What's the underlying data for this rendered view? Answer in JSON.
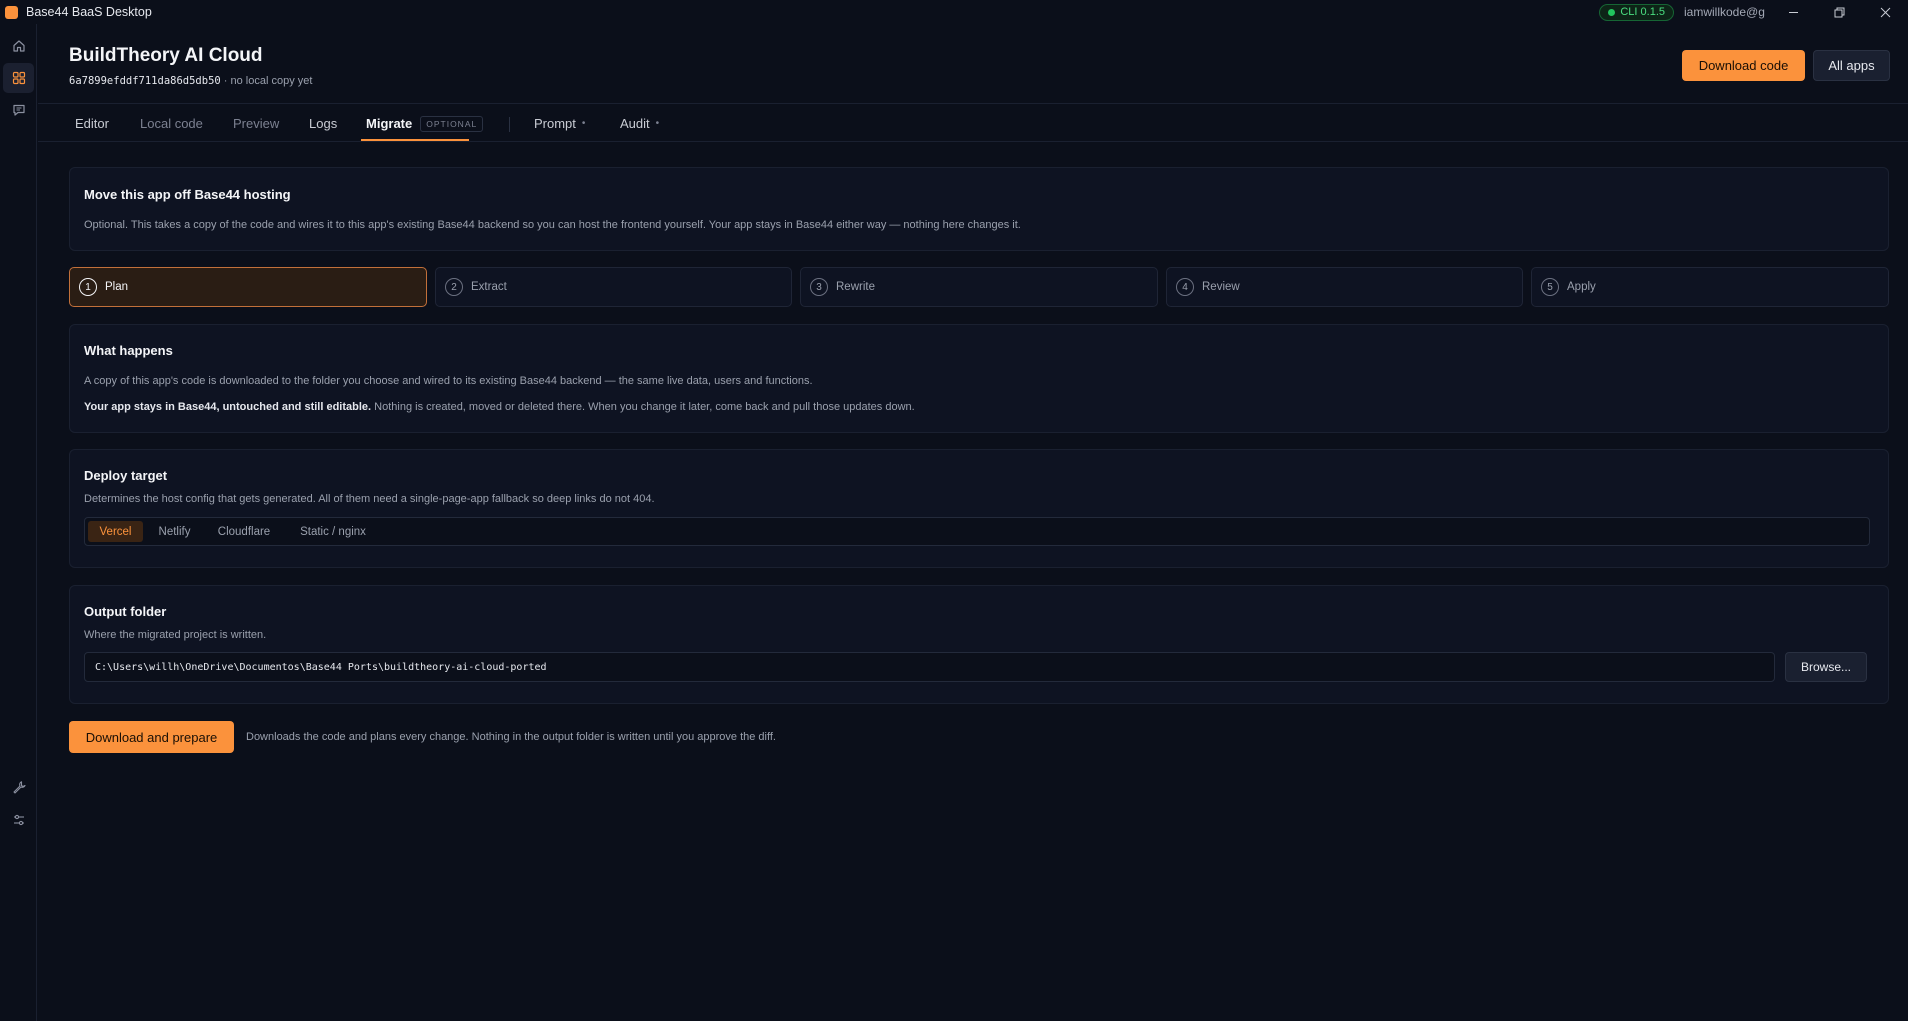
{
  "window": {
    "title": "Base44 BaaS Desktop",
    "cli_badge": "CLI 0.1.5",
    "user": "iamwillkode@g"
  },
  "header": {
    "app_name": "BuildTheory AI Cloud",
    "app_id": "6a7899efddf711da86d5db50",
    "app_status": "· no local copy yet",
    "download_code": "Download code",
    "all_apps": "All apps"
  },
  "tabs": {
    "editor": "Editor",
    "local_code": "Local code",
    "preview": "Preview",
    "logs": "Logs",
    "migrate": "Migrate",
    "migrate_badge": "OPTIONAL",
    "prompt": "Prompt",
    "audit": "Audit",
    "dot": "•"
  },
  "intro": {
    "title": "Move this app off Base44 hosting",
    "text": "Optional. This takes a copy of the code and wires it to this app's existing Base44 backend so you can host the frontend yourself. Your app stays in Base44 either way — nothing here changes it."
  },
  "steps": [
    {
      "num": "1",
      "label": "Plan"
    },
    {
      "num": "2",
      "label": "Extract"
    },
    {
      "num": "3",
      "label": "Rewrite"
    },
    {
      "num": "4",
      "label": "Review"
    },
    {
      "num": "5",
      "label": "Apply"
    }
  ],
  "what_happens": {
    "title": "What happens",
    "line1": "A copy of this app's code is downloaded to the folder you choose and wired to its existing Base44 backend — the same live data, users and functions.",
    "line2_bold": "Your app stays in Base44, untouched and still editable.",
    "line2_rest": " Nothing is created, moved or deleted there. When you change it later, come back and pull those updates down."
  },
  "deploy": {
    "title": "Deploy target",
    "subtitle": "Determines the host config that gets generated. All of them need a single-page-app fallback so deep links do not 404.",
    "options": [
      "Vercel",
      "Netlify",
      "Cloudflare",
      "Static / nginx"
    ],
    "selected": "Vercel"
  },
  "output": {
    "title": "Output folder",
    "subtitle": "Where the migrated project is written.",
    "path": "C:\\Users\\willh\\OneDrive\\Documentos\\Base44 Ports\\buildtheory-ai-cloud-ported",
    "browse": "Browse..."
  },
  "action": {
    "button": "Download and prepare",
    "note": "Downloads the code and plans every change. Nothing in the output folder is written until you approve the diff."
  },
  "colors": {
    "accent": "#fb923c",
    "background": "#0b0f1a",
    "card": "#0e1322",
    "cli_green": "#4ade80"
  }
}
